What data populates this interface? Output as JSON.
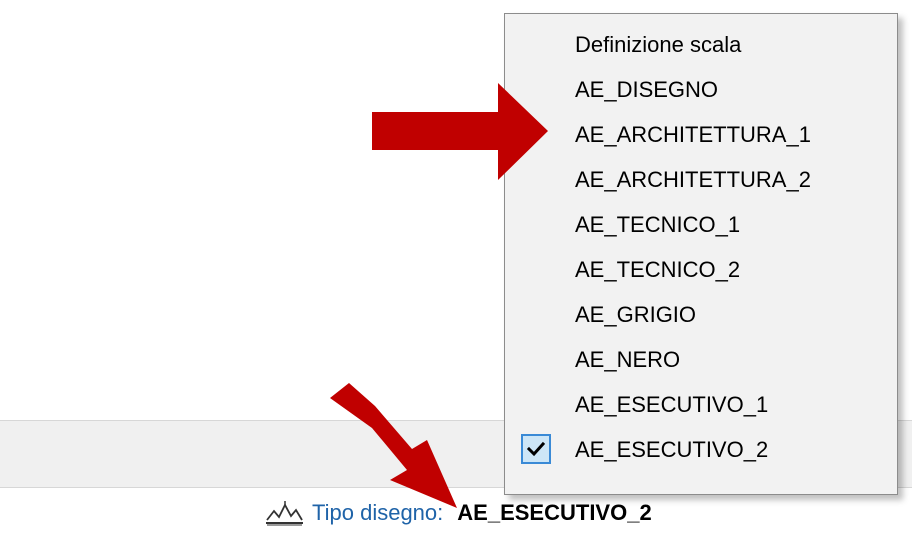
{
  "menu": {
    "items": [
      {
        "label": "Definizione scala",
        "checked": false
      },
      {
        "label": "AE_DISEGNO",
        "checked": false
      },
      {
        "label": "AE_ARCHITETTURA_1",
        "checked": false
      },
      {
        "label": "AE_ARCHITETTURA_2",
        "checked": false
      },
      {
        "label": "AE_TECNICO_1",
        "checked": false
      },
      {
        "label": "AE_TECNICO_2",
        "checked": false
      },
      {
        "label": "AE_GRIGIO",
        "checked": false
      },
      {
        "label": "AE_NERO",
        "checked": false
      },
      {
        "label": "AE_ESECUTIVO_1",
        "checked": false
      },
      {
        "label": "AE_ESECUTIVO_2",
        "checked": true
      }
    ]
  },
  "status": {
    "icon": "drawing-type-icon",
    "label": "Tipo disegno:",
    "value": "AE_ESECUTIVO_2"
  },
  "colors": {
    "annotation_arrow": "#c00000",
    "label_blue": "#1f63a8",
    "check_border": "#3a8ad6"
  }
}
